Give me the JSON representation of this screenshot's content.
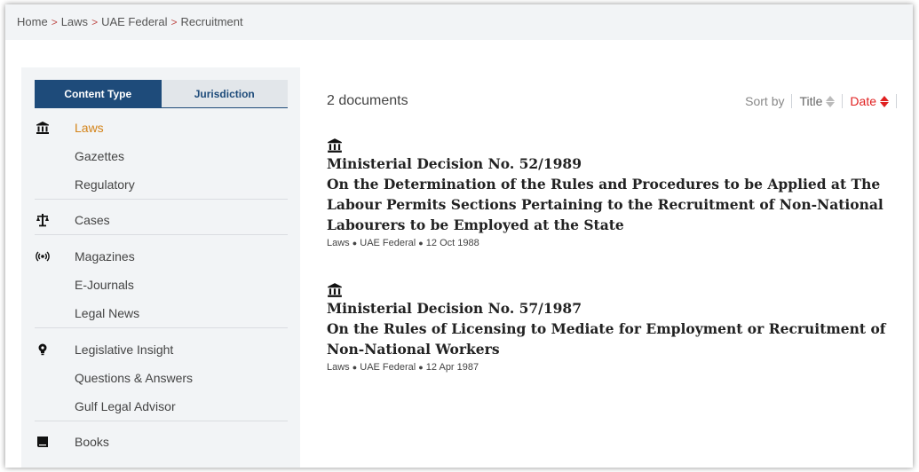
{
  "breadcrumb": {
    "home": "Home",
    "laws": "Laws",
    "uae": "UAE Federal",
    "current": "Recruitment",
    "separator": ">"
  },
  "sidebar": {
    "tabs": {
      "content_type": "Content Type",
      "jurisdiction": "Jurisdiction"
    },
    "groups": [
      {
        "icon": "institution-icon",
        "items": [
          "Laws",
          "Gazettes",
          "Regulatory"
        ],
        "active": "Laws"
      },
      {
        "icon": "scales-icon",
        "items": [
          "Cases"
        ]
      },
      {
        "icon": "broadcast-icon",
        "items": [
          "Magazines",
          "E-Journals",
          "Legal News"
        ]
      },
      {
        "icon": "lightbulb-icon",
        "items": [
          "Legislative Insight",
          "Questions & Answers",
          "Gulf Legal Advisor"
        ]
      },
      {
        "icon": "book-icon",
        "items": [
          "Books"
        ]
      }
    ]
  },
  "main": {
    "count": "2 documents",
    "sort": {
      "label": "Sort by",
      "title": "Title",
      "date": "Date"
    },
    "docs": [
      {
        "icon": "institution-icon",
        "line1": "Ministerial Decision No. 52/1989",
        "line2": "On the Determination of the Rules and Procedures to be Applied at The",
        "line3": "Labour Permits Sections Pertaining to the Recruitment of Non-National",
        "line4": "Labourers to be Employed at the State",
        "meta_type": "Laws",
        "meta_juris": "UAE Federal",
        "meta_date": "12 Oct 1988"
      },
      {
        "icon": "institution-icon",
        "line1": "Ministerial Decision No. 57/1987",
        "line2": "On the Rules of Licensing to Mediate for Employment or Recruitment of",
        "line3": "Non-National Workers",
        "meta_type": "Laws",
        "meta_juris": "UAE Federal",
        "meta_date": "12 Apr 1987"
      }
    ]
  },
  "colors": {
    "accent_blue": "#1e4b7a",
    "active_orange": "#d4841a",
    "sort_red": "#e02020",
    "sidebar_bg": "#f2f4f6"
  }
}
